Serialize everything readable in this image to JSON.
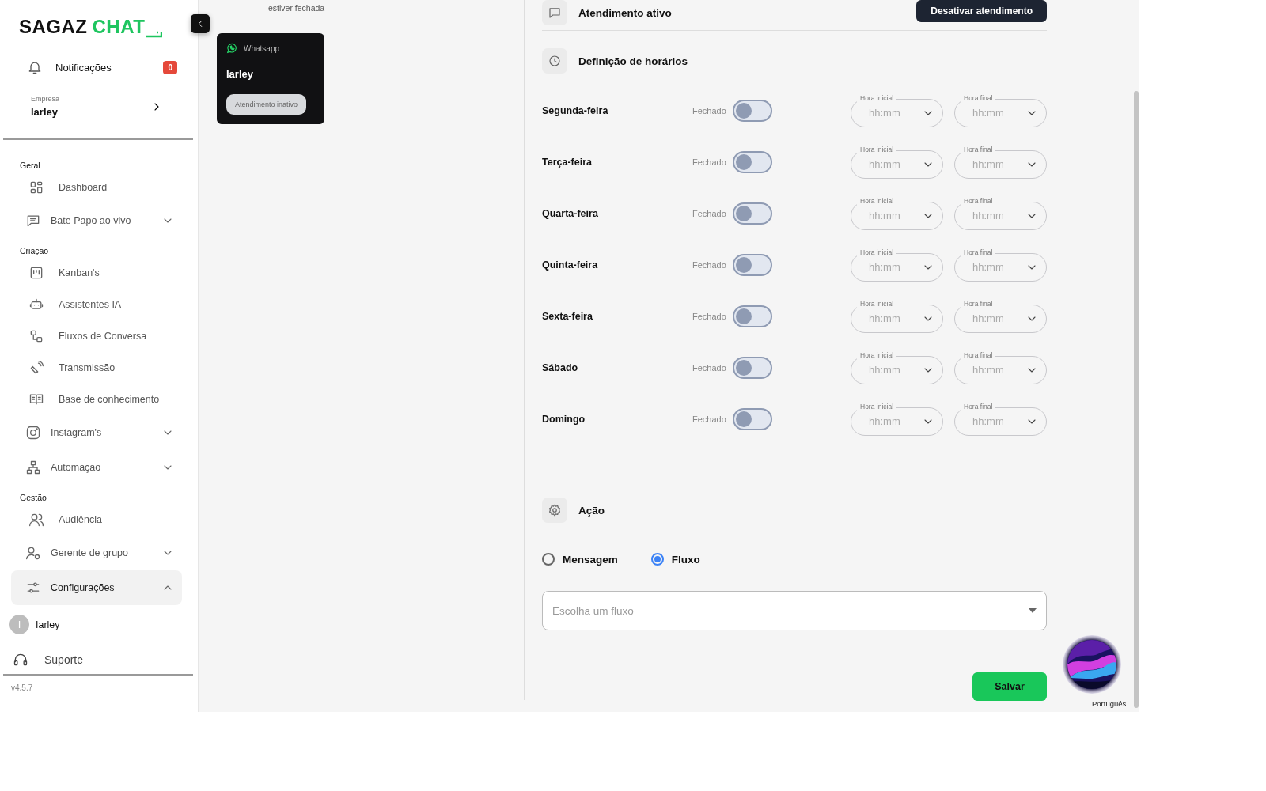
{
  "sidebar": {
    "logo": {
      "dark": "SAGAZ",
      "accent": "CHAT"
    },
    "notifications": {
      "label": "Notificações",
      "count": "0"
    },
    "company": {
      "caption": "Empresa",
      "name": "Iarley"
    },
    "sections": [
      {
        "title": "Geral",
        "items": [
          {
            "label": "Dashboard",
            "kind": "link",
            "expanded": false
          },
          {
            "label": "Bate Papo ao vivo",
            "kind": "group",
            "expanded": false
          }
        ]
      },
      {
        "title": "Criação",
        "items": [
          {
            "label": "Kanban's",
            "kind": "link",
            "expanded": false
          },
          {
            "label": "Assistentes IA",
            "kind": "link",
            "expanded": false
          },
          {
            "label": "Fluxos de Conversa",
            "kind": "link",
            "expanded": false
          },
          {
            "label": "Transmissão",
            "kind": "link",
            "expanded": false
          },
          {
            "label": "Base de conhecimento",
            "kind": "link",
            "expanded": false
          },
          {
            "label": "Instagram's",
            "kind": "group",
            "expanded": false
          },
          {
            "label": "Automação",
            "kind": "group",
            "expanded": false
          }
        ]
      },
      {
        "title": "Gestão",
        "items": [
          {
            "label": "Audiência",
            "kind": "link",
            "expanded": false
          },
          {
            "label": "Gerente de grupo",
            "kind": "group",
            "expanded": false
          },
          {
            "label": "Configurações",
            "kind": "group",
            "expanded": true
          }
        ]
      }
    ],
    "user": {
      "initial": "I",
      "name": "Iarley"
    },
    "support": "Suporte",
    "version": "v4.5.7"
  },
  "middle": {
    "note": "estiver fechada",
    "channel_card": {
      "channel": "Whatsapp",
      "name": "Iarley",
      "status": "Atendimento inativo"
    }
  },
  "settings": {
    "active_section": {
      "title": "Atendimento ativo",
      "button": "Desativar atendimento"
    },
    "schedule": {
      "title": "Definição de horários",
      "days": [
        {
          "day": "Segunda-feira",
          "status": "Fechado",
          "on": false,
          "start": {
            "label": "Hora inicial",
            "placeholder": "hh:mm"
          },
          "end": {
            "label": "Hora final",
            "placeholder": "hh:mm"
          }
        },
        {
          "day": "Terça-feira",
          "status": "Fechado",
          "on": false,
          "start": {
            "label": "Hora inicial",
            "placeholder": "hh:mm"
          },
          "end": {
            "label": "Hora final",
            "placeholder": "hh:mm"
          }
        },
        {
          "day": "Quarta-feira",
          "status": "Fechado",
          "on": false,
          "start": {
            "label": "Hora inicial",
            "placeholder": "hh:mm"
          },
          "end": {
            "label": "Hora final",
            "placeholder": "hh:mm"
          }
        },
        {
          "day": "Quinta-feira",
          "status": "Fechado",
          "on": false,
          "start": {
            "label": "Hora inicial",
            "placeholder": "hh:mm"
          },
          "end": {
            "label": "Hora final",
            "placeholder": "hh:mm"
          }
        },
        {
          "day": "Sexta-feira",
          "status": "Fechado",
          "on": false,
          "start": {
            "label": "Hora inicial",
            "placeholder": "hh:mm"
          },
          "end": {
            "label": "Hora final",
            "placeholder": "hh:mm"
          }
        },
        {
          "day": "Sábado",
          "status": "Fechado",
          "on": false,
          "start": {
            "label": "Hora inicial",
            "placeholder": "hh:mm"
          },
          "end": {
            "label": "Hora final",
            "placeholder": "hh:mm"
          }
        },
        {
          "day": "Domingo",
          "status": "Fechado",
          "on": false,
          "start": {
            "label": "Hora inicial",
            "placeholder": "hh:mm"
          },
          "end": {
            "label": "Hora final",
            "placeholder": "hh:mm"
          }
        }
      ]
    },
    "action": {
      "title": "Ação",
      "options": [
        {
          "label": "Mensagem",
          "selected": false
        },
        {
          "label": "Fluxo",
          "selected": true
        }
      ],
      "flow_select": {
        "placeholder": "Escolha um fluxo"
      }
    },
    "save": "Salvar"
  },
  "assistant": {
    "language": "Português"
  }
}
